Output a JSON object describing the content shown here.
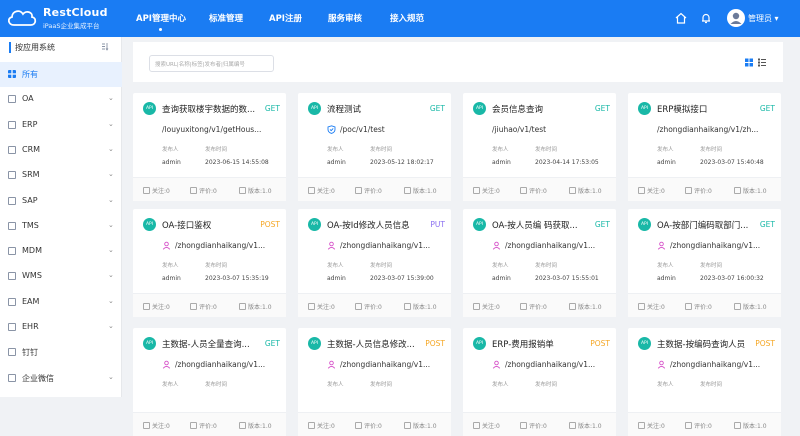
{
  "brand": {
    "name": "RestCloud",
    "subtitle": "iPaaS企业集成平台"
  },
  "nav": [
    "API管理中心",
    "标准管理",
    "API注册",
    "服务审核",
    "接入规范"
  ],
  "user": {
    "name": "管理员 ▾"
  },
  "sidebar": {
    "header": "按应用系统",
    "items": [
      {
        "label": "所有",
        "active": true,
        "has_chevron": false
      },
      {
        "label": "OA",
        "has_chevron": true
      },
      {
        "label": "ERP",
        "has_chevron": true
      },
      {
        "label": "CRM",
        "has_chevron": true
      },
      {
        "label": "SRM",
        "has_chevron": true
      },
      {
        "label": "SAP",
        "has_chevron": true
      },
      {
        "label": "TMS",
        "has_chevron": true
      },
      {
        "label": "MDM",
        "has_chevron": true
      },
      {
        "label": "WMS",
        "has_chevron": true
      },
      {
        "label": "EAM",
        "has_chevron": true
      },
      {
        "label": "EHR",
        "has_chevron": true
      },
      {
        "label": "钉钉",
        "has_chevron": false
      },
      {
        "label": "企业微信",
        "has_chevron": true
      }
    ]
  },
  "search": {
    "placeholder": "搜索URL|名称|标签|发布者|归属编号"
  },
  "card_labels": {
    "publisher": "发布人",
    "publish_time": "发布时间",
    "follow": "关注:0",
    "rating": "评价:0",
    "version": "版本:1.0",
    "api_badge": "API"
  },
  "cards": [
    {
      "title": "查询获取楼宇数据的数...",
      "method": "GET",
      "path": "/louyuxitong/v1/getHous...",
      "icon": "",
      "publisher": "admin",
      "time": "2023-06-15 14:55:08"
    },
    {
      "title": "流程测试",
      "method": "GET",
      "path": "/poc/v1/test",
      "icon": "shield-icon",
      "publisher": "admin",
      "time": "2023-05-12 18:02:17"
    },
    {
      "title": "会员信息查询",
      "method": "GET",
      "path": "/jiuhao/v1/test",
      "icon": "",
      "publisher": "admin",
      "time": "2023-04-14 17:53:05"
    },
    {
      "title": "ERP模拟接口",
      "method": "GET",
      "path": "/zhongdianhaikang/v1/zh...",
      "icon": "",
      "publisher": "admin",
      "time": "2023-03-07 15:40:48"
    },
    {
      "title": "OA-接口鉴权",
      "method": "POST",
      "path": "/zhongdianhaikang/v1...",
      "icon": "user-icon",
      "publisher": "admin",
      "time": "2023-03-07 15:35:19"
    },
    {
      "title": "OA-按Id修改人员信息",
      "method": "PUT",
      "path": "/zhongdianhaikang/v1...",
      "icon": "user-icon",
      "publisher": "admin",
      "time": "2023-03-07 15:39:00"
    },
    {
      "title": "OA-按人员编 码获取...",
      "method": "GET",
      "path": "/zhongdianhaikang/v1...",
      "icon": "user-icon",
      "publisher": "admin",
      "time": "2023-03-07 15:55:01"
    },
    {
      "title": "OA-按部门编码取部门...",
      "method": "GET",
      "path": "/zhongdianhaikang/v1...",
      "icon": "user-icon",
      "publisher": "admin",
      "time": "2023-03-07 16:00:32"
    },
    {
      "title": "主数据-人员全量查询...",
      "method": "GET",
      "path": "/zhongdianhaikang/v1...",
      "icon": "user-icon",
      "publisher": "",
      "time": ""
    },
    {
      "title": "主数据-人员信息修改...",
      "method": "POST",
      "path": "/zhongdianhaikang/v1...",
      "icon": "user-icon",
      "publisher": "",
      "time": ""
    },
    {
      "title": "ERP-费用报销单",
      "method": "POST",
      "path": "/zhongdianhaikang/v1...",
      "icon": "user-icon",
      "publisher": "",
      "time": ""
    },
    {
      "title": "主数据-按编码查询人员",
      "method": "POST",
      "path": "/zhongdianhaikang/v1...",
      "icon": "user-icon",
      "publisher": "",
      "time": ""
    }
  ],
  "colors": {
    "primary": "#1a7cf3",
    "api_badge": "#19b8a7",
    "get": "#19b8a7",
    "post": "#f5a623",
    "put": "#8a6ef0"
  }
}
